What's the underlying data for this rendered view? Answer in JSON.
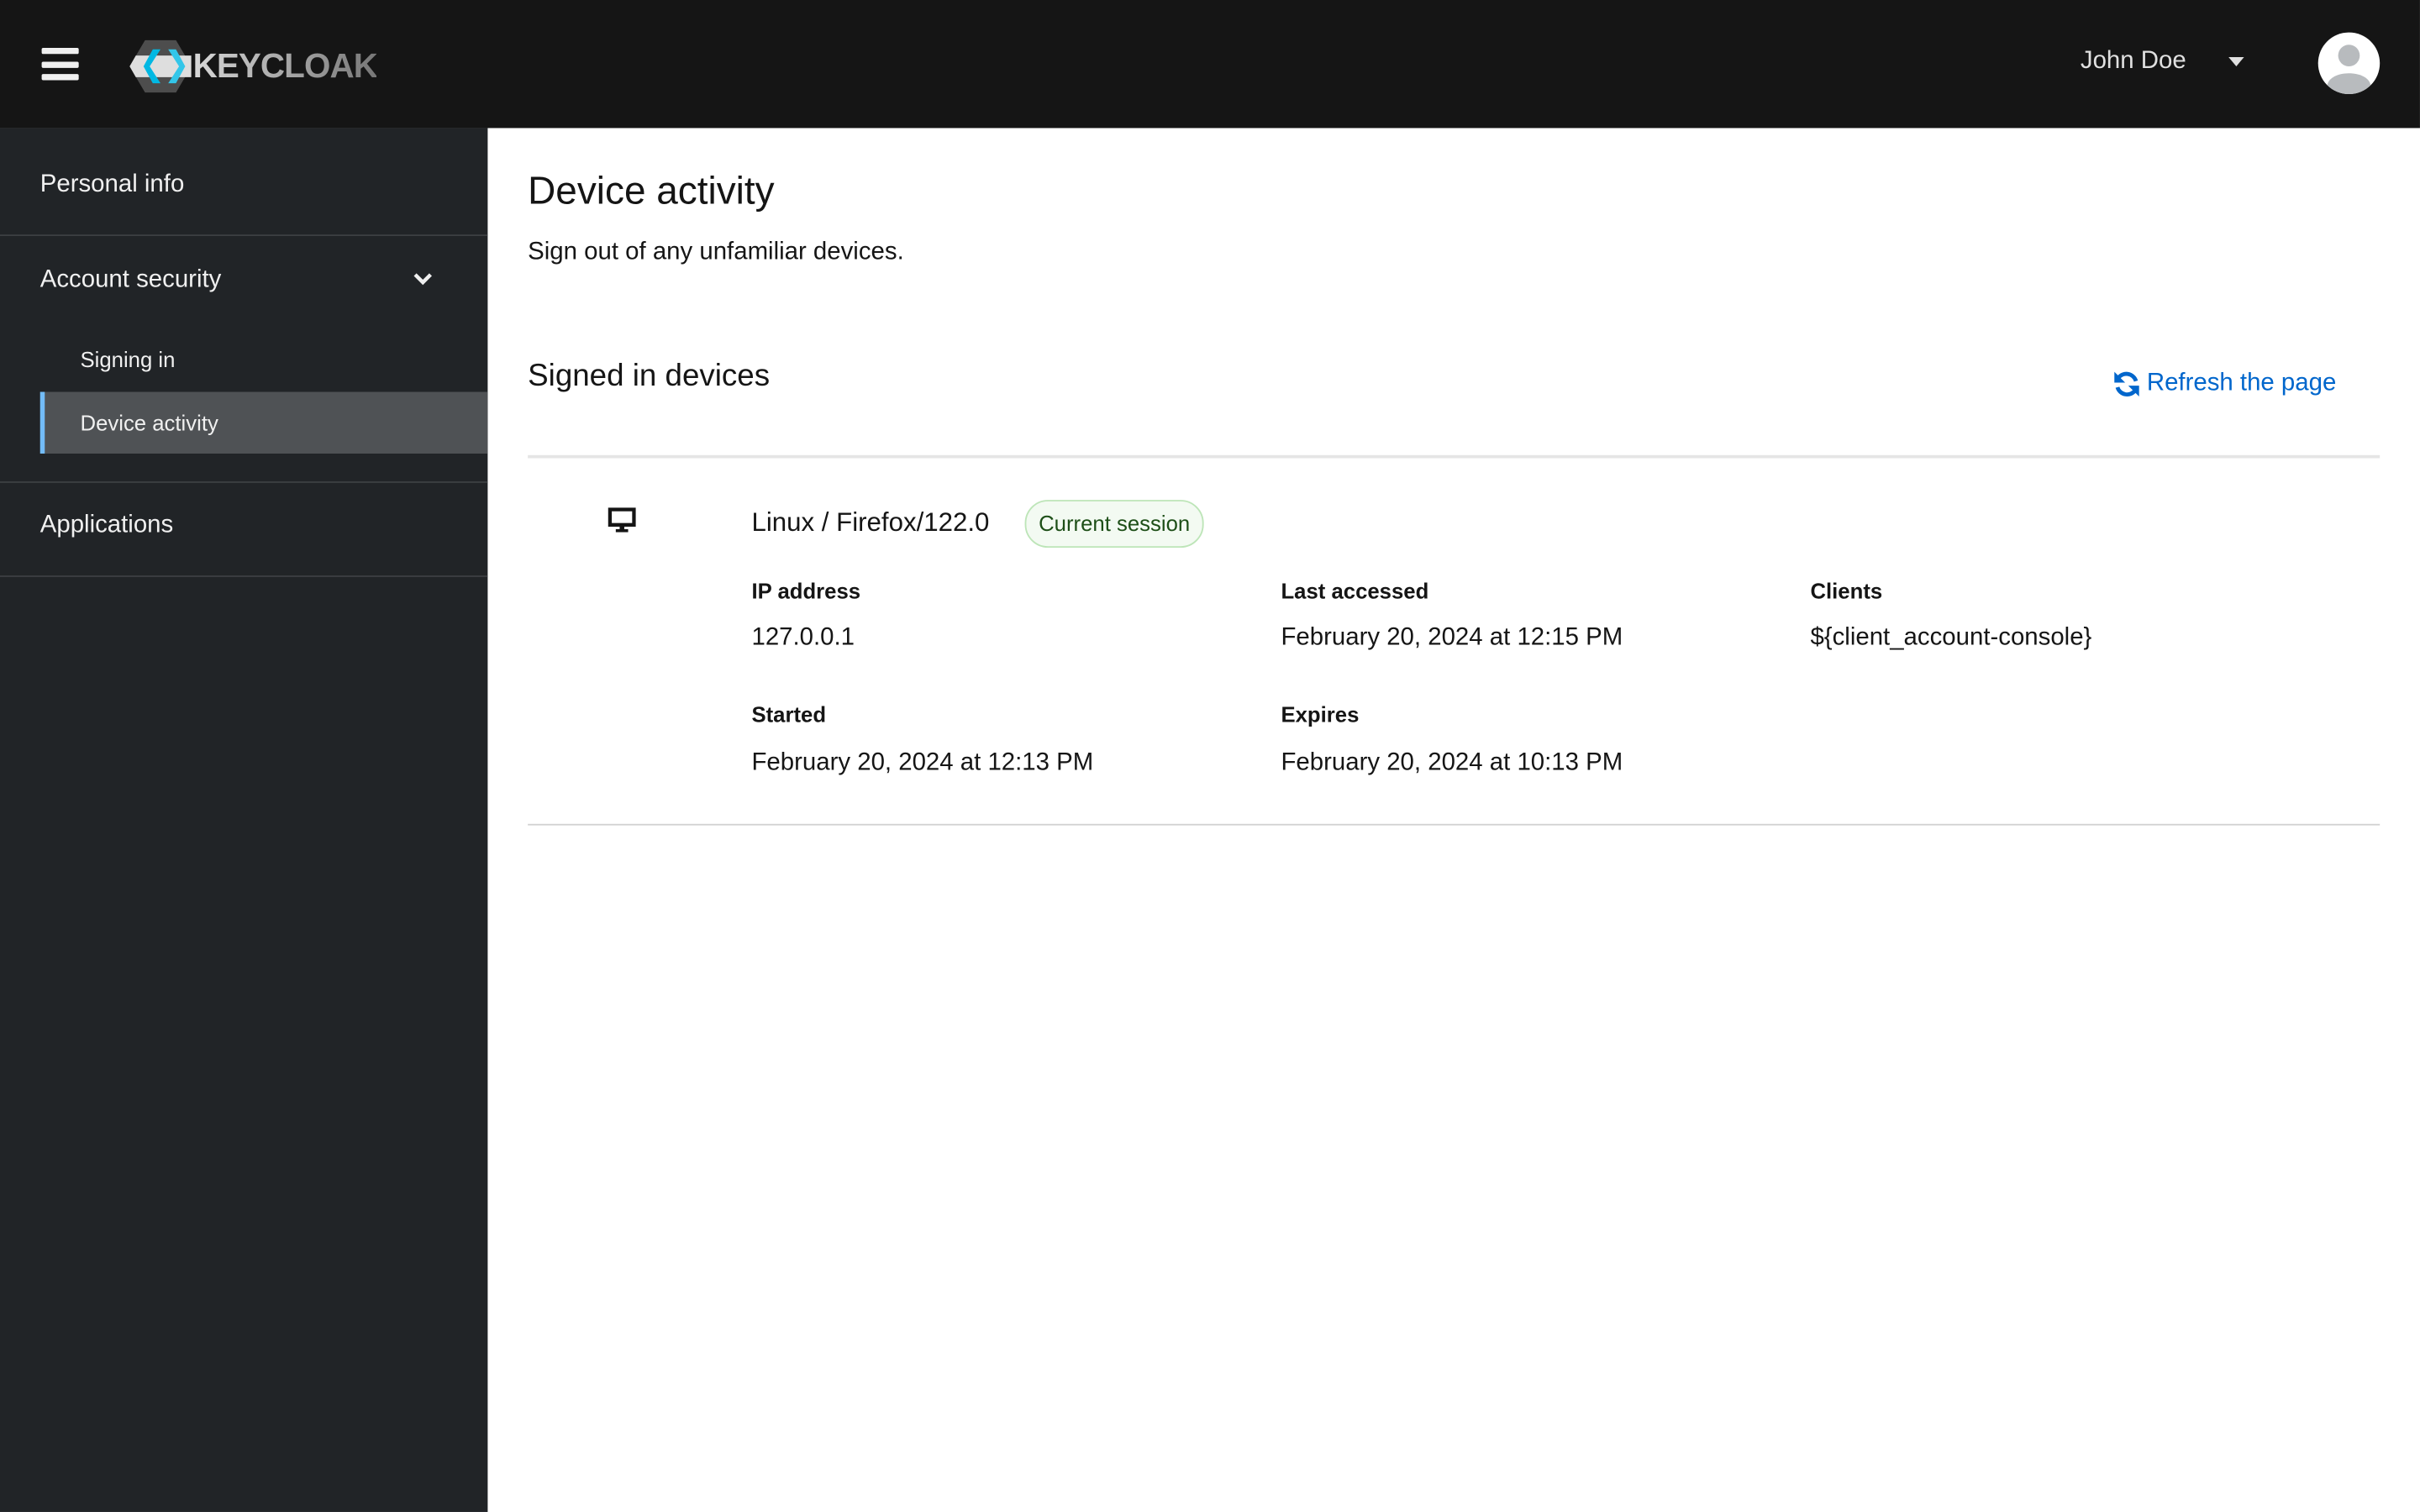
{
  "header": {
    "logo_text": "KEYCLOAK",
    "user_name": "John Doe"
  },
  "sidebar": {
    "items": [
      {
        "label": "Personal info"
      },
      {
        "label": "Account security",
        "children": [
          {
            "label": "Signing in"
          },
          {
            "label": "Device activity",
            "active": true
          }
        ]
      },
      {
        "label": "Applications"
      }
    ]
  },
  "page": {
    "title": "Device activity",
    "subtitle": "Sign out of any unfamiliar devices.",
    "section_title": "Signed in devices",
    "refresh_label": "Refresh the page"
  },
  "device": {
    "name": "Linux / Firefox/122.0",
    "badge": "Current session",
    "fields": {
      "ip_label": "IP address",
      "ip": "127.0.0.1",
      "last_label": "Last accessed",
      "last": "February 20, 2024 at 12:15 PM",
      "clients_label": "Clients",
      "clients": "${client_account-console}",
      "started_label": "Started",
      "started": "February 20, 2024 at 12:13 PM",
      "expires_label": "Expires",
      "expires": "February 20, 2024 at 10:13 PM"
    }
  },
  "colors": {
    "accent": "#0066cc",
    "nav_active": "#73bcf7",
    "header_bg": "#151515",
    "sidebar_bg": "#212427"
  }
}
